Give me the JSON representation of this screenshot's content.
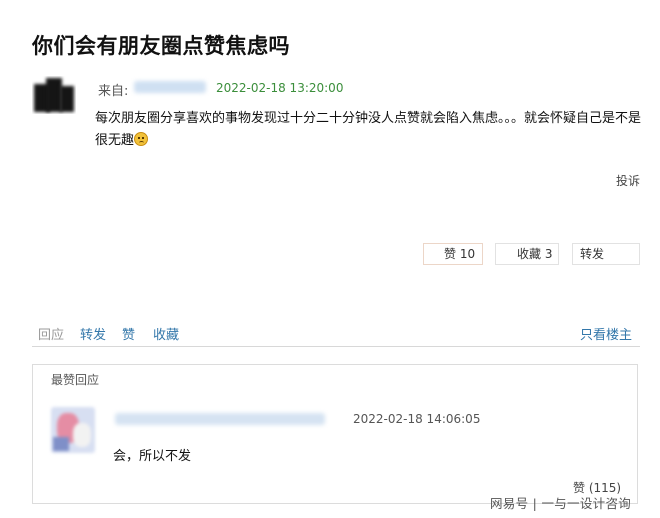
{
  "post": {
    "title": "你们会有朋友圈点赞焦虑吗",
    "from_label": "来自:",
    "time": "2022-02-18 13:20:00",
    "body": "每次朋友圈分享喜欢的事物发现过十分二十分钟没人点赞就会陷入焦虑。。。就会怀疑自己是不是很无趣",
    "body_emoji": "sad-face-emoji",
    "report_label": "投诉"
  },
  "actions": {
    "like_label": "赞 10",
    "favorite_label": "收藏 3",
    "forward_label": "转发"
  },
  "nav": {
    "reply": "回应",
    "forward": "转发",
    "like": "赞",
    "favorite": "收藏",
    "author_only": "只看楼主"
  },
  "best_reply": {
    "section_title": "最赞回应",
    "time": "2022-02-18 14:06:05",
    "text": "会，所以不发",
    "like_label": "赞 (115)"
  },
  "watermark": "网易号 | 一与一设计咨询",
  "colors": {
    "link": "#3377aa",
    "time_green": "#3b8e3b",
    "border": "#dcdcdc"
  }
}
